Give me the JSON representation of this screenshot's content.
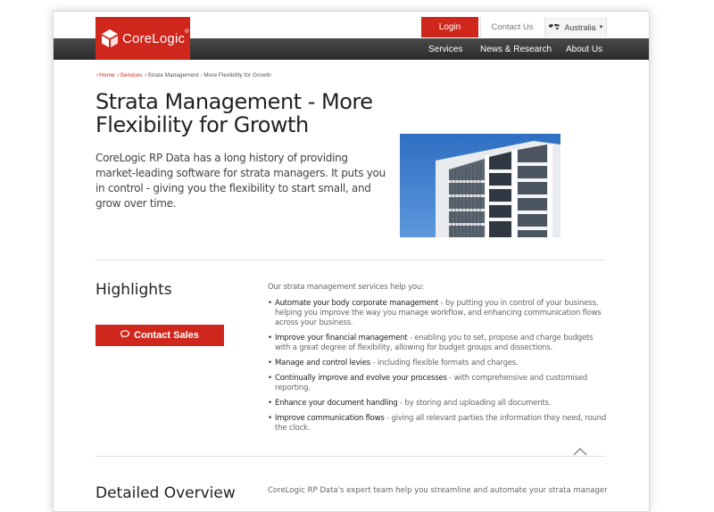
{
  "logo": {
    "text": "CoreLogic",
    "mark": "®"
  },
  "topbar": {
    "login": "Login",
    "contact": "Contact Us",
    "region": "Australia"
  },
  "nav": {
    "items": [
      "Services",
      "News & Research",
      "About Us"
    ]
  },
  "breadcrumb": {
    "home": "Home",
    "services": "Services",
    "current": "Strata Management - More Flexibility for Growth"
  },
  "hero": {
    "title": "Strata Management - More Flexibility for Growth",
    "intro": "CoreLogic RP Data has a long history of providing market-leading software for strata managers. It puts you in control - giving you the flexibility to start small, and grow over time."
  },
  "highlights": {
    "heading": "Highlights",
    "button": "Contact Sales",
    "lead": "Our strata management services help you:",
    "items": [
      {
        "bold": "Automate your body corporate management",
        "text": " - by putting you in control of your business, helping you improve the way you manage workflow, and enhancing communication flows across your business."
      },
      {
        "bold": "Improve your financial management",
        "text": " - enabling you to set, propose and charge budgets with a great degree of flexibility, allowing for budget groups and dissections."
      },
      {
        "bold": "Manage and control levies",
        "text": " - including flexible formats and charges."
      },
      {
        "bold": "Continually improve and evolve your processes",
        "text": " - with comprehensive and customised reporting."
      },
      {
        "bold": "Enhance your document handling",
        "text": " - by storing and uploading all documents."
      },
      {
        "bold": "Improve communication flows",
        "text": " - giving all relevant parties the information they need, round the clock."
      }
    ]
  },
  "overview": {
    "heading": "Detailed Overview",
    "text": "CoreLogic RP Data's expert team help you streamline and automate your strata management"
  },
  "icons": {
    "globe": "globe-icon",
    "caret": "caret-down-icon",
    "chat": "chat-icon",
    "up": "chevron-up-icon"
  },
  "colors": {
    "brand": "#d0271d",
    "navbar": "#333333"
  }
}
